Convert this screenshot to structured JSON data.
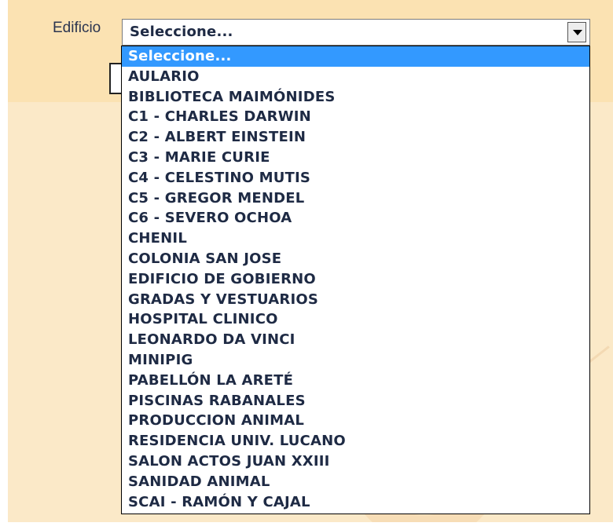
{
  "form": {
    "label": "Edificio",
    "select": {
      "value": "Seleccione..."
    }
  },
  "dropdown": {
    "highlighted_index": 0,
    "options": [
      "Seleccione...",
      "AULARIO",
      "BIBLIOTECA MAIMÓNIDES",
      "C1 - CHARLES DARWIN",
      "C2 - ALBERT EINSTEIN",
      "C3 - MARIE CURIE",
      "C4 - CELESTINO MUTIS",
      "C5 - GREGOR MENDEL",
      "C6 - SEVERO OCHOA",
      "CHENIL",
      "COLONIA SAN JOSE",
      "EDIFICIO DE GOBIERNO",
      "GRADAS Y VESTUARIOS",
      "HOSPITAL CLINICO",
      "LEONARDO DA VINCI",
      "MINIPIG",
      "PABELLÓN LA ARETÉ",
      "PISCINAS RABANALES",
      "PRODUCCION ANIMAL",
      "RESIDENCIA UNIV. LUCANO",
      "SALON ACTOS JUAN XXIII",
      "SANIDAD ANIMAL",
      "SCAI - RAMÓN Y CAJAL"
    ]
  },
  "colors": {
    "panel_background": "#fbe2b2",
    "highlight": "#3399ff",
    "option_text": "#1e2a44"
  },
  "icons": {
    "select_arrow": "chevron-down-icon"
  }
}
